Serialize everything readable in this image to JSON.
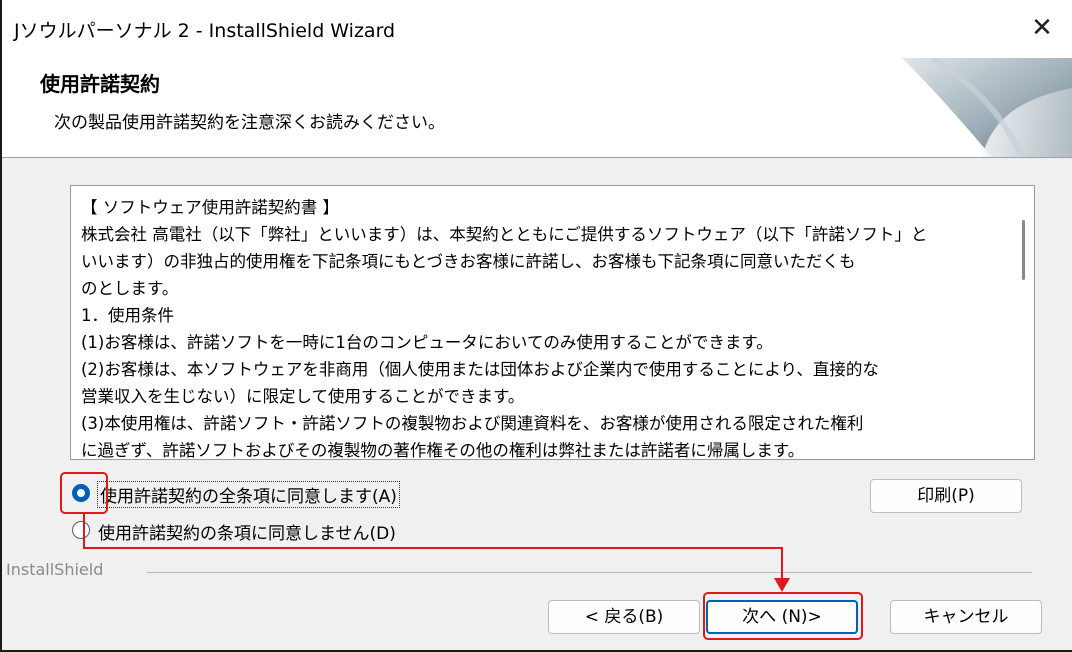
{
  "window": {
    "title": "Jソウルパーソナル 2 - InstallShield Wizard",
    "close_glyph": "✕"
  },
  "header": {
    "title": "使用許諾契約",
    "subtitle": "次の製品使用許諾契約を注意深くお読みください。"
  },
  "license": {
    "lines": [
      "【 ソフトウェア使用許諾契約書 】",
      "株式会社 高電社（以下「弊社」といいます）は、本契約とともにご提供するソフトウェア（以下「許諾ソフト」と",
      "いいます）の非独占的使用権を下記条項にもとづきお客様に許諾し、お客様も下記条項に同意いただくも",
      "のとします。",
      "1．使用条件",
      "(1)お客様は、許諾ソフトを一時に1台のコンピュータにおいてのみ使用することができます。",
      "(2)お客様は、本ソフトウェアを非商用（個人使用または団体および企業内で使用することにより、直接的な",
      "営業収入を生じない）に限定して使用することができます。",
      "(3)本使用権は、許諾ソフト・許諾ソフトの複製物および関連資料を、お客様が使用される限定された権利",
      "に過ぎず、許諾ソフトおよびその複製物の著作権その他の権利は弊社または許諾者に帰属します。"
    ]
  },
  "options": {
    "accept_label": "使用許諾契約の全条項に同意します(A)",
    "decline_label": "使用許諾契約の条項に同意しません(D)",
    "accept_selected": true
  },
  "buttons": {
    "print": "印刷(P)",
    "back": "< 戻る(B)",
    "next": "次へ (N)>",
    "cancel": "キャンセル"
  },
  "branding": {
    "text": "InstallShield"
  },
  "colors": {
    "accent": "#005fb8",
    "highlight": "#e01818"
  }
}
